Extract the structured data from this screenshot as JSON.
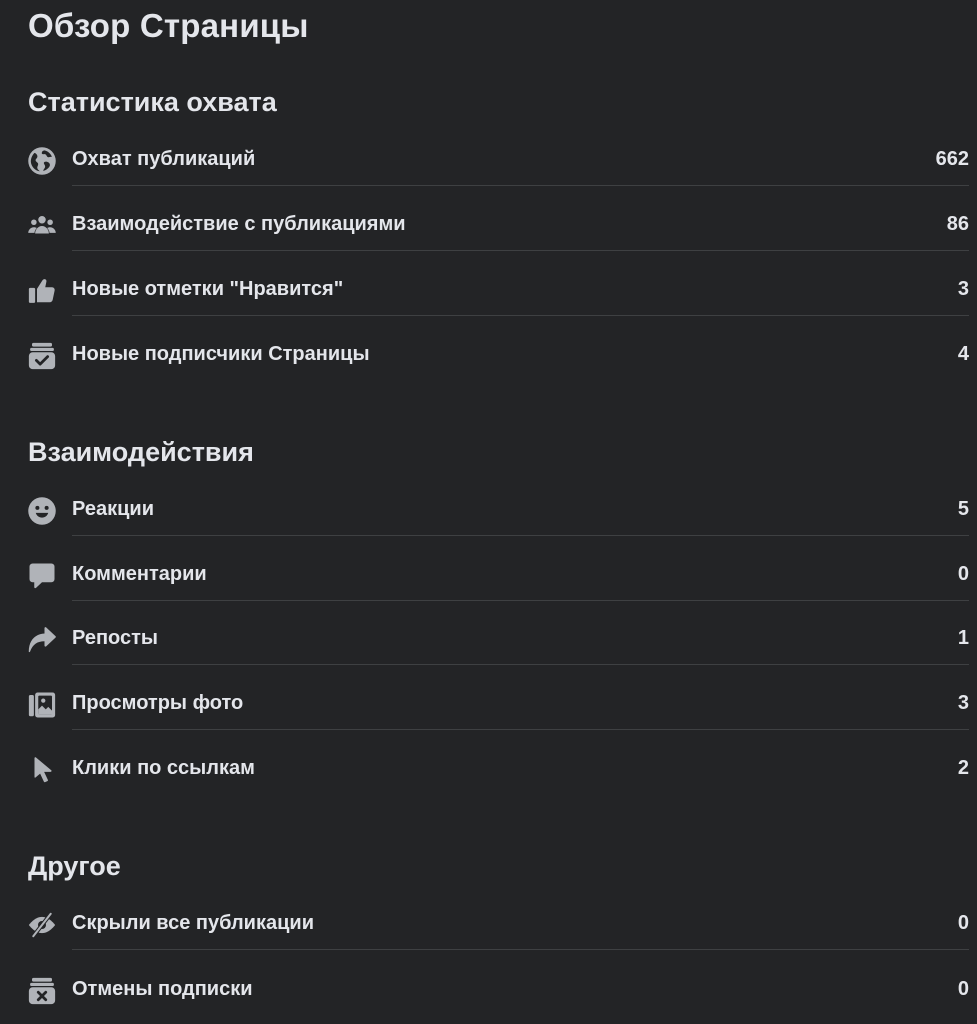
{
  "page": {
    "title": "Обзор Страницы"
  },
  "sections": [
    {
      "title": "Статистика охвата",
      "items": [
        {
          "icon": "globe-icon",
          "label": "Охват публикаций",
          "value": "662"
        },
        {
          "icon": "people-icon",
          "label": "Взаимодействие с публикациями",
          "value": "86"
        },
        {
          "icon": "thumbs-up-icon",
          "label": "Новые отметки \"Нравится\"",
          "value": "3"
        },
        {
          "icon": "inbox-check-icon",
          "label": "Новые подписчики Страницы",
          "value": "4"
        }
      ]
    },
    {
      "title": "Взаимодействия",
      "items": [
        {
          "icon": "smiley-icon",
          "label": "Реакции",
          "value": "5"
        },
        {
          "icon": "comment-icon",
          "label": "Комментарии",
          "value": "0"
        },
        {
          "icon": "share-arrow-icon",
          "label": "Репосты",
          "value": "1"
        },
        {
          "icon": "photos-icon",
          "label": "Просмотры фото",
          "value": "3"
        },
        {
          "icon": "cursor-icon",
          "label": "Клики по ссылкам",
          "value": "2"
        }
      ]
    },
    {
      "title": "Другое",
      "items": [
        {
          "icon": "eye-slash-icon",
          "label": "Скрыли все публикации",
          "value": "0"
        },
        {
          "icon": "inbox-x-icon",
          "label": "Отмены подписки",
          "value": "0"
        }
      ]
    }
  ],
  "colors": {
    "background": "#232426",
    "text": "#e4e6eb",
    "icon": "#b0b3b8",
    "divider": "#3e4042"
  }
}
